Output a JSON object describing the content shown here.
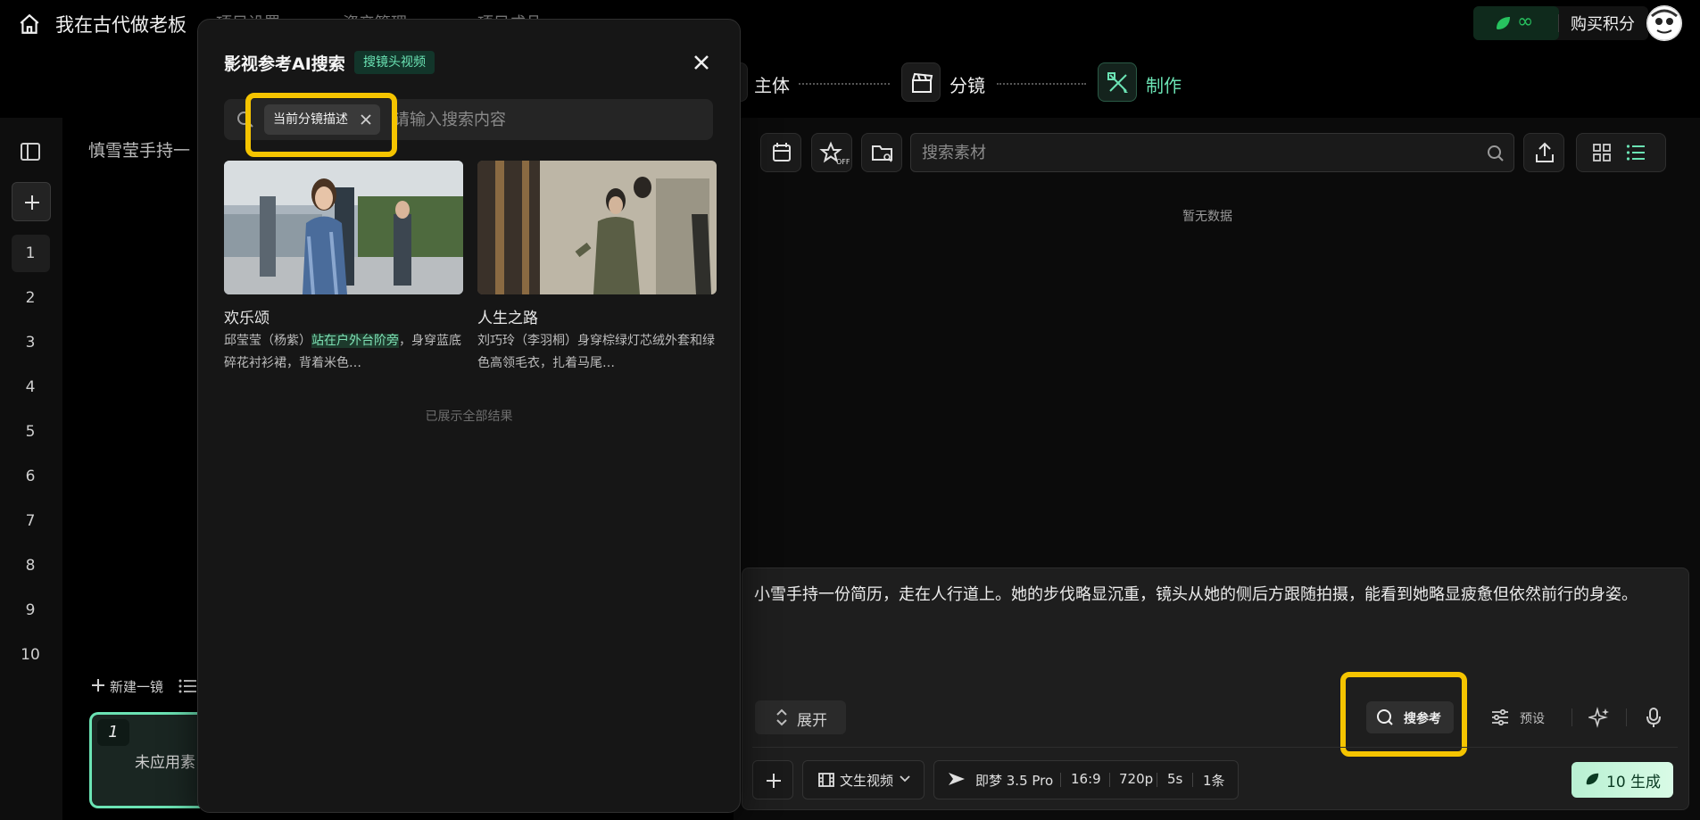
{
  "app": {
    "title": "我在古代做老板",
    "nav": [
      "项目设置",
      "资产管理",
      "项目成品"
    ],
    "credits_symbol": "∞",
    "buy_label": "购买积分"
  },
  "steps": [
    {
      "label": "主体"
    },
    {
      "label": "分镜"
    },
    {
      "label": "制作"
    }
  ],
  "sidebar": {
    "shots": [
      "1",
      "2",
      "3",
      "4",
      "5",
      "6",
      "7",
      "8",
      "9",
      "10"
    ],
    "active_shot": "1"
  },
  "midpanel": {
    "heading": "慎雪莹手持一",
    "new_shot_label": "新建一镜",
    "card_number": "1",
    "card_text": "未应用素"
  },
  "assets": {
    "search_placeholder": "搜索素材",
    "empty_text": "暂无数据"
  },
  "prompt": {
    "text": "小雪手持一份简历，走在人行道上。她的步伐略显沉重，镜头从她的侧后方跟随拍摄，能看到她略显疲惫但依然前行的身姿。",
    "expand_label": "展开",
    "ref_search_label": "搜参考",
    "preset_label": "预设",
    "mode_label": "文生视频",
    "model_label": "即梦 3.5 Pro",
    "ratio": "16:9",
    "resolution": "720p",
    "duration": "5s",
    "count": "1条",
    "generate_label": "10 生成"
  },
  "modal": {
    "title": "影视参考AI搜索",
    "tag": "搜镜头视频",
    "chip_label": "当前分镜描述",
    "search_placeholder": "请输入搜索内容",
    "results": [
      {
        "title": "欢乐颂",
        "desc_before": "邱莹莹（杨紫）",
        "desc_highlight": "站在户外台阶旁",
        "desc_after": "，身穿蓝底碎花衬衫裙，背着米色…"
      },
      {
        "title": "人生之路",
        "desc_before": "刘巧玲（李羽桐）身穿棕绿灯芯绒外套和绿色高领毛衣，扎着马尾…",
        "desc_highlight": "",
        "desc_after": ""
      }
    ],
    "end_text": "已展示全部结果"
  },
  "colors": {
    "accent_green": "#6be3b4",
    "highlight_yellow": "#f5c400",
    "generate_bg": "#c6f4db"
  }
}
